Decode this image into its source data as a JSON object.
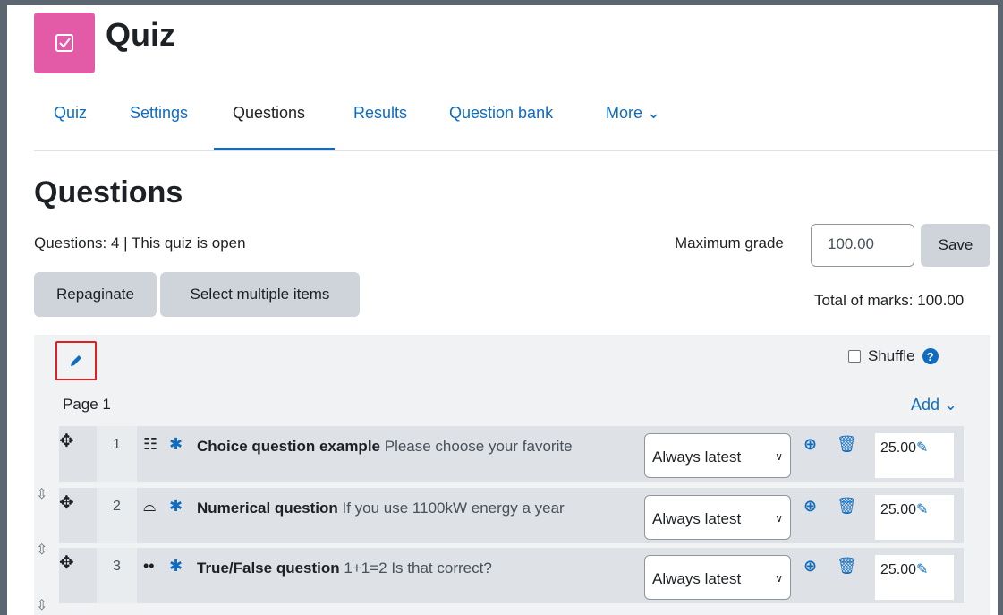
{
  "header": {
    "title": "Quiz",
    "icon": "checkbox-icon",
    "accent": "#e35aa6"
  },
  "nav": {
    "tabs": [
      {
        "label": "Quiz"
      },
      {
        "label": "Settings"
      },
      {
        "label": "Questions",
        "active": true
      },
      {
        "label": "Results"
      },
      {
        "label": "Question bank"
      },
      {
        "label": "More ⌄"
      }
    ]
  },
  "page": {
    "heading": "Questions",
    "status": "Questions: 4 | This quiz is open",
    "max_grade_label": "Maximum grade",
    "max_grade_value": "100.00",
    "save_label": "Save",
    "repaginate_label": "Repaginate",
    "select_multiple_label": "Select multiple items",
    "total_marks": "Total of marks: 100.00"
  },
  "section": {
    "shuffle_label": "Shuffle",
    "page_label": "Page 1",
    "add_label": "Add ⌄"
  },
  "questions": [
    {
      "num": "1",
      "type_icon": "multichoice-icon",
      "name": "Choice question example",
      "text": "Please choose your favorite",
      "version": "Always latest",
      "mark": "25.00"
    },
    {
      "num": "2",
      "type_icon": "numerical-icon",
      "name": "Numerical question",
      "text": "If you use 1100kW energy a year",
      "version": "Always latest",
      "mark": "25.00"
    },
    {
      "num": "3",
      "type_icon": "truefalse-icon",
      "name": "True/False question",
      "text": "1+1=2 Is that correct?",
      "version": "Always latest",
      "mark": "25.00"
    }
  ],
  "colors": {
    "link": "#0f6cbf",
    "highlight_border": "#e02020"
  }
}
